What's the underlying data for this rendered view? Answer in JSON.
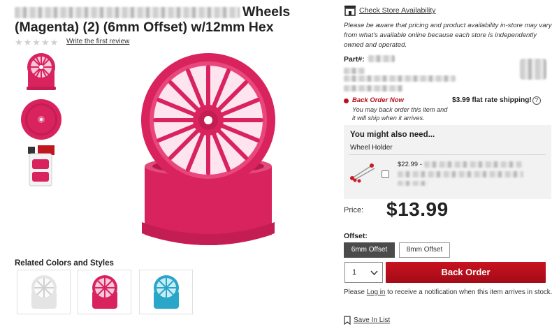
{
  "product": {
    "title_visible": "Wheels (Magenta) (2) (6mm Offset) w/12mm Hex",
    "review_link": "Write the first review",
    "stars": "★★★★★",
    "related_title": "Related Colors and Styles",
    "related": [
      {
        "color_name": "white",
        "color": "#e4e4e4"
      },
      {
        "color_name": "magenta",
        "color": "#d9235f"
      },
      {
        "color_name": "blue",
        "color": "#2aa6c9"
      }
    ],
    "wheel_color": "#d9235f"
  },
  "store": {
    "check_link": "Check Store Availability",
    "notice": "Please be aware that pricing and product availability in-store may vary from what's available online because each store is independently owned and operated.",
    "part_label": "Part#:"
  },
  "availability": {
    "status": "Back Order Now",
    "note": "You may back order this item and it will ship when it arrives.",
    "shipping": "$3.99 flat rate shipping!",
    "help_glyph": "?"
  },
  "upsell": {
    "title": "You might also need...",
    "item_name": "Wheel Holder",
    "price_prefix": "$22.99 -"
  },
  "purchase": {
    "price_label": "Price:",
    "price": "$13.99",
    "offset_label": "Offset:",
    "options": [
      "6mm Offset",
      "8mm Offset"
    ],
    "selected_option": "6mm Offset",
    "quantity": "1",
    "cta": "Back Order",
    "login_pre": "Please ",
    "login_link": "Log in",
    "login_post": " to receive a notification when this item arrives in stock.",
    "save_link": "Save In List"
  },
  "colors": {
    "accent_red": "#b8101c",
    "selected_option_bg": "#4b4b4b",
    "upsell_bg": "#f2f2f2"
  }
}
